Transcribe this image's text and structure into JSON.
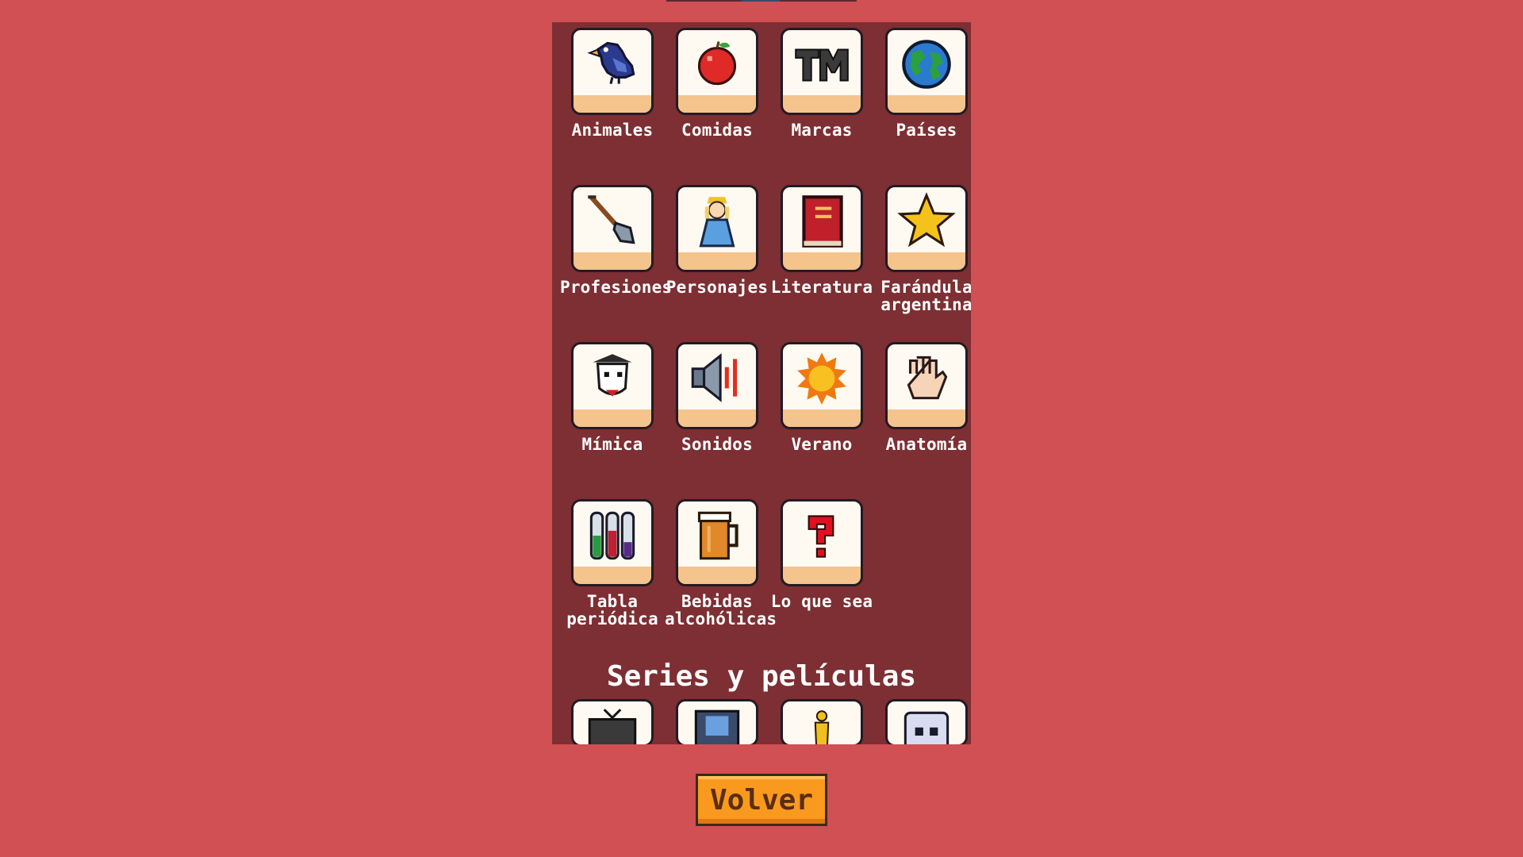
{
  "categories": [
    {
      "label": "Animales",
      "icon": "bird-icon"
    },
    {
      "label": "Comidas",
      "icon": "apple-icon"
    },
    {
      "label": "Marcas",
      "icon": "trademark-icon"
    },
    {
      "label": "Países",
      "icon": "globe-icon"
    },
    {
      "label": "Profesiones",
      "icon": "shovel-icon"
    },
    {
      "label": "Personajes",
      "icon": "princess-icon"
    },
    {
      "label": "Literatura",
      "icon": "book-icon"
    },
    {
      "label": "Farándula argentina",
      "icon": "star-icon"
    },
    {
      "label": "Mímica",
      "icon": "mime-icon"
    },
    {
      "label": "Sonidos",
      "icon": "speaker-icon"
    },
    {
      "label": "Verano",
      "icon": "sun-icon"
    },
    {
      "label": "Anatomía",
      "icon": "hand-icon"
    },
    {
      "label": "Tabla periódica",
      "icon": "test-tubes-icon"
    },
    {
      "label": "Bebidas alcohólicas",
      "icon": "beer-icon"
    },
    {
      "label": "Lo que sea",
      "icon": "question-mark-icon"
    }
  ],
  "section": {
    "title": "Series y películas"
  },
  "section_items": [
    {
      "icon": "tv-icon"
    },
    {
      "icon": "film-icon"
    },
    {
      "icon": "oscar-icon"
    },
    {
      "icon": "ghost-icon"
    }
  ],
  "back_button": {
    "label": "Volver"
  },
  "colors": {
    "background": "#d05054",
    "panel": "#7d2f33",
    "button": "#f99a1e"
  }
}
